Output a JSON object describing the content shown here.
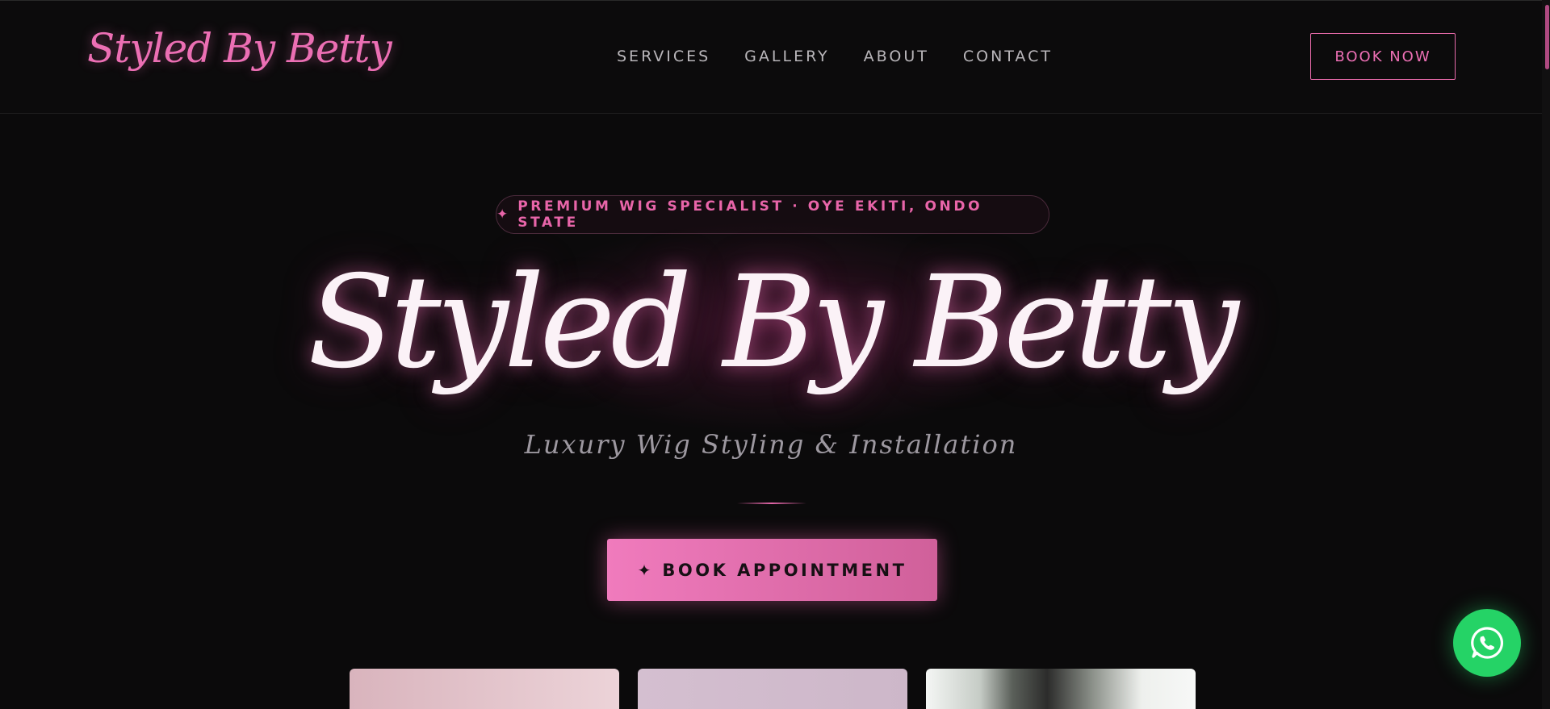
{
  "nav": {
    "logo": "Styled By Betty",
    "links": [
      "SERVICES",
      "GALLERY",
      "ABOUT",
      "CONTACT"
    ],
    "book_now": "BOOK NOW"
  },
  "hero": {
    "badge_icon": "sparkle-icon",
    "badge_text": "PREMIUM WIG SPECIALIST · OYE EKITI, ONDO STATE",
    "title": "Styled By Betty",
    "subtitle": "Luxury Wig Styling & Installation",
    "cta_icon": "sparkle-icon",
    "cta_label": "BOOK APPOINTMENT"
  },
  "floating": {
    "whatsapp_icon": "whatsapp-icon"
  },
  "colors": {
    "accent": "#ec6fb4",
    "background": "#0b0a0b",
    "whatsapp": "#25d366"
  }
}
